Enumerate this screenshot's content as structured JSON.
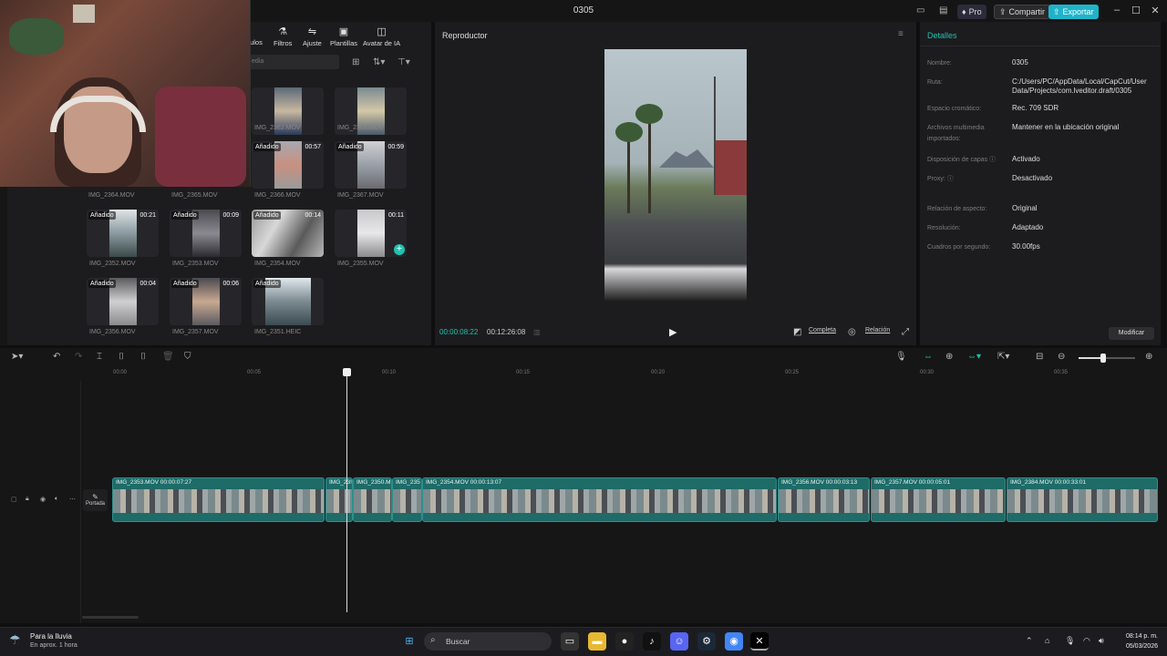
{
  "window": {
    "title": "0305",
    "pro_label": "Pro",
    "share_label": "Compartir",
    "export_label": "Exportar"
  },
  "media_tabs": [
    {
      "label": "tulos",
      "icon": "text-icon"
    },
    {
      "label": "Filtros",
      "icon": "filter-icon"
    },
    {
      "label": "Ajuste",
      "icon": "adjust-icon"
    },
    {
      "label": "Plantillas",
      "icon": "template-icon"
    },
    {
      "label": "Avatar de IA",
      "icon": "avatar-icon"
    }
  ],
  "media_search_placeholder": "edia",
  "media_items": [
    {
      "name": "IMG_2364.MOV",
      "badge": "",
      "duration": ""
    },
    {
      "name": "IMG_2365.MOV",
      "badge": "",
      "duration": ""
    },
    {
      "name": "IMG_2362.MOV",
      "badge": "",
      "duration": ""
    },
    {
      "name": "IMG_2363.MOV",
      "badge": "",
      "duration": ""
    },
    {
      "name": "IMG_2366.MOV",
      "badge": "Añadido",
      "duration": "00:57"
    },
    {
      "name": "IMG_2367.MOV",
      "badge": "Añadido",
      "duration": "00:59"
    },
    {
      "name": "IMG_2352.MOV",
      "badge": "Añadido",
      "duration": "00:21"
    },
    {
      "name": "IMG_2353.MOV",
      "badge": "Añadido",
      "duration": "00:09"
    },
    {
      "name": "IMG_2354.MOV",
      "badge": "Añadido",
      "duration": "00:14"
    },
    {
      "name": "IMG_2355.MOV",
      "badge": "",
      "duration": "00:11"
    },
    {
      "name": "IMG_2356.MOV",
      "badge": "Añadido",
      "duration": "00:04"
    },
    {
      "name": "IMG_2357.MOV",
      "badge": "Añadido",
      "duration": "00:06"
    },
    {
      "name": "IMG_2351.HEIC",
      "badge": "Añadido",
      "duration": ""
    }
  ],
  "player": {
    "title": "Reproductor",
    "current_time": "00:00:08:22",
    "total_time": "00:12:26:08",
    "full_label": "Completa",
    "ratio_label": "Relación"
  },
  "details": {
    "title": "Detalles",
    "rows": [
      {
        "key": "Nombre:",
        "value": "0305"
      },
      {
        "key": "Ruta:",
        "value": "C:/Users/PC/AppData/Local/CapCut/User Data/Projects/com.lveditor.draft/0305"
      },
      {
        "key": "Espacio cromático:",
        "value": "Rec. 709 SDR"
      },
      {
        "key": "Archivos multimedia importados:",
        "value": "Mantener en la ubicación original"
      },
      {
        "key": "Disposición de capas ⓘ",
        "value": "Activado"
      },
      {
        "key": "Proxy: ⓘ",
        "value": "Desactivado"
      },
      {
        "key": "Relación de aspecto:",
        "value": "Original"
      },
      {
        "key": "Resolución:",
        "value": "Adaptado"
      },
      {
        "key": "Cuadros por segundo:",
        "value": "30.00fps"
      }
    ],
    "modify_label": "Modificar"
  },
  "ruler_ticks": [
    "00:00",
    "00:05",
    "00:10",
    "00:15",
    "00:20",
    "00:25",
    "00:30",
    "00:35"
  ],
  "track": {
    "cover_label": "Portada"
  },
  "clips": [
    {
      "label": "IMG_2353.MOV  00:00:07:27"
    },
    {
      "label": "IMG_23!"
    },
    {
      "label": "IMG_2350.M"
    },
    {
      "label": "IMG_235"
    },
    {
      "label": "IMG_2354.MOV  00:00:13:07"
    },
    {
      "label": "IMG_2356.MOV  00:00:03:13"
    },
    {
      "label": "IMG_2357.MOV  00:00:05:01"
    },
    {
      "label": "IMG_2384.MOV  00:00:33:01"
    }
  ],
  "taskbar": {
    "weather_title": "Para la lluvia",
    "weather_sub": "En aprox. 1 hora",
    "search_placeholder": "Buscar",
    "time": "08:14 p. m.",
    "date": "05/03/2026"
  }
}
